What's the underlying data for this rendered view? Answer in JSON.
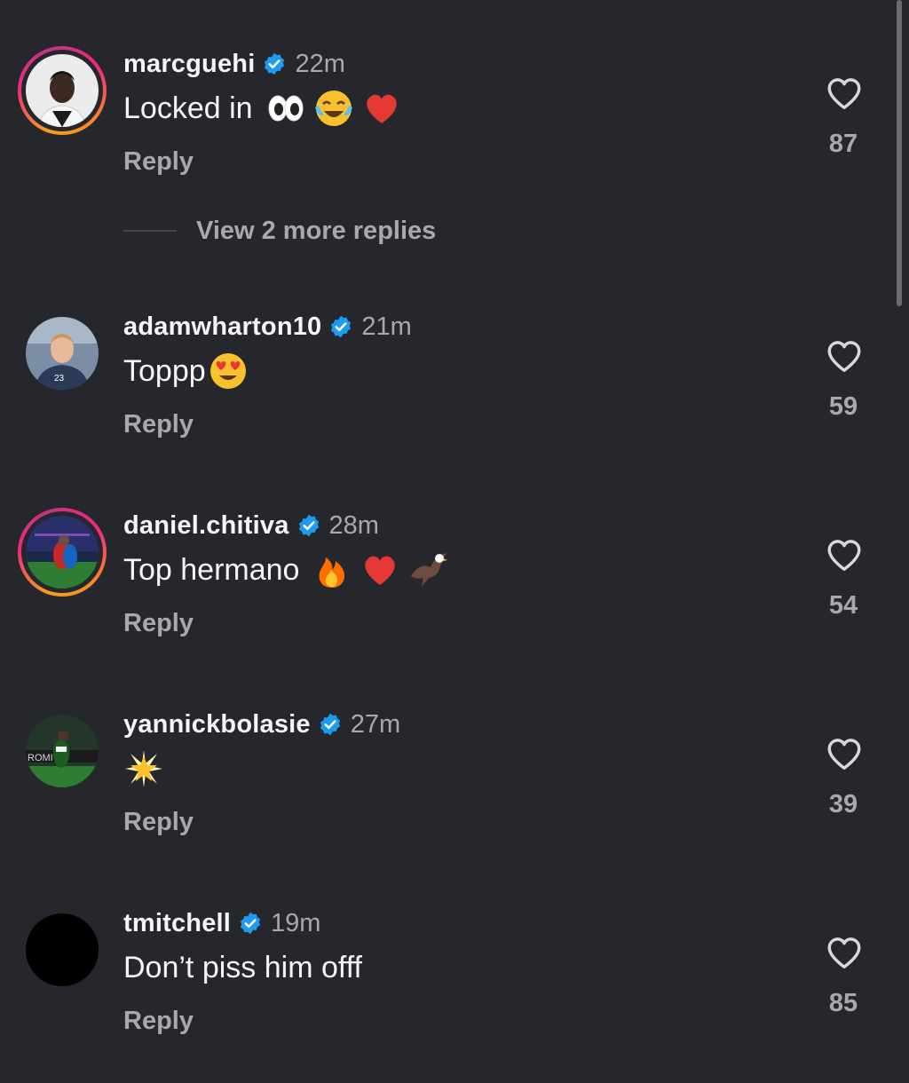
{
  "comments": [
    {
      "username": "marcguehi",
      "time": "22m",
      "text": "Locked in",
      "emojis": [
        "eyes",
        "joy",
        "heart"
      ],
      "reply_label": "Reply",
      "likes": "87",
      "story_ring": true
    },
    {
      "username": "adamwharton10",
      "time": "21m",
      "text": "Toppp",
      "emojis": [
        "heart-eyes"
      ],
      "reply_label": "Reply",
      "likes": "59",
      "story_ring": false
    },
    {
      "username": "daniel.chitiva",
      "time": "28m",
      "text": "Top hermano",
      "emojis": [
        "fire",
        "heart",
        "eagle"
      ],
      "reply_label": "Reply",
      "likes": "54",
      "story_ring": true
    },
    {
      "username": "yannickbolasie",
      "time": "27m",
      "text": "",
      "emojis": [
        "glowing-star"
      ],
      "reply_label": "Reply",
      "likes": "39",
      "story_ring": false
    },
    {
      "username": "tmitchell",
      "time": "19m",
      "text": "Don’t piss him offf",
      "emojis": [],
      "reply_label": "Reply",
      "likes": "85",
      "story_ring": false
    }
  ],
  "view_more_replies": "View 2 more replies",
  "colors": {
    "background": "#25272c",
    "secondary_text": "#a7a9ad",
    "verified_blue": "#1d9bf0"
  }
}
